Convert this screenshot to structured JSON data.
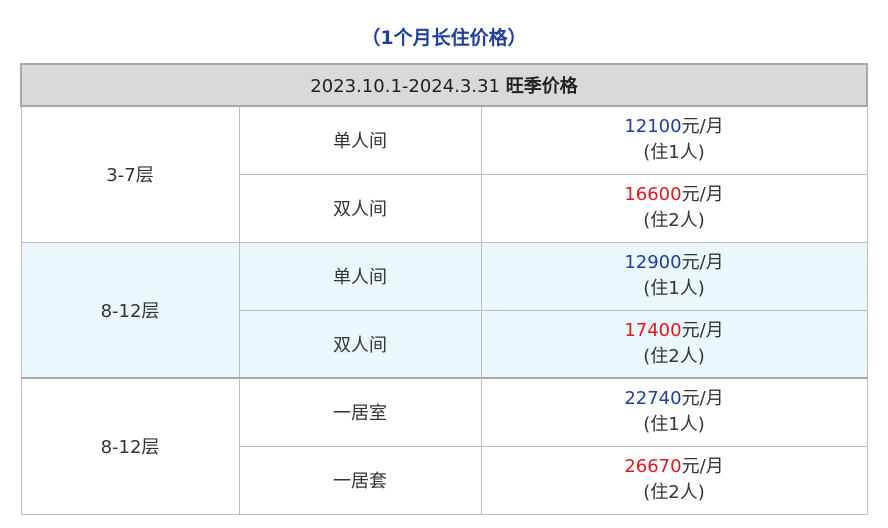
{
  "subtitle": "（1个月长住价格）",
  "header": {
    "period": "2023.10.1-2024.3.31",
    "season": "旺季价格"
  },
  "unit": "元/月",
  "groups": [
    {
      "floor": "3-7层",
      "rooms": [
        {
          "type": "单人间",
          "price": "12100",
          "price_color": "#1f3f9b",
          "occupancy": "(住1人)"
        },
        {
          "type": "双人间",
          "price": "16600",
          "price_color": "#e0191f",
          "occupancy": "(住2人)"
        }
      ]
    },
    {
      "floor": "8-12层",
      "rooms": [
        {
          "type": "单人间",
          "price": "12900",
          "price_color": "#1f3f9b",
          "occupancy": "(住1人)"
        },
        {
          "type": "双人间",
          "price": "17400",
          "price_color": "#e0191f",
          "occupancy": "(住2人)"
        }
      ]
    },
    {
      "floor": "8-12层",
      "rooms": [
        {
          "type": "一居室",
          "price": "22740",
          "price_color": "#1f3f9b",
          "occupancy": "(住1人)"
        },
        {
          "type": "一居套",
          "price": "26670",
          "price_color": "#e0191f",
          "occupancy": "(住2人)"
        }
      ]
    }
  ],
  "colors": {
    "title_blue": "#1f3f9b",
    "price_red": "#e0191f",
    "header_bg": "#d9d9d9",
    "alt_row_bg": "#eaf8fc"
  }
}
